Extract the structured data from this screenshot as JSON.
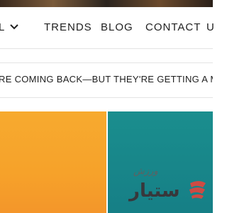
{
  "nav": {
    "items": [
      {
        "label": "L",
        "has_dropdown": true
      },
      {
        "label": "TRENDS"
      },
      {
        "label": "BLOG"
      },
      {
        "label": "CONTACT"
      },
      {
        "label": "U"
      }
    ]
  },
  "ticker": {
    "text": "RE COMING BACK—BUT THEY'RE GETTING A MODERN"
  },
  "tiles": {
    "left_color": "#f6a22a",
    "right_color": "#178588"
  },
  "watermark": {
    "small": "ورزش",
    "large": "ستیار"
  }
}
